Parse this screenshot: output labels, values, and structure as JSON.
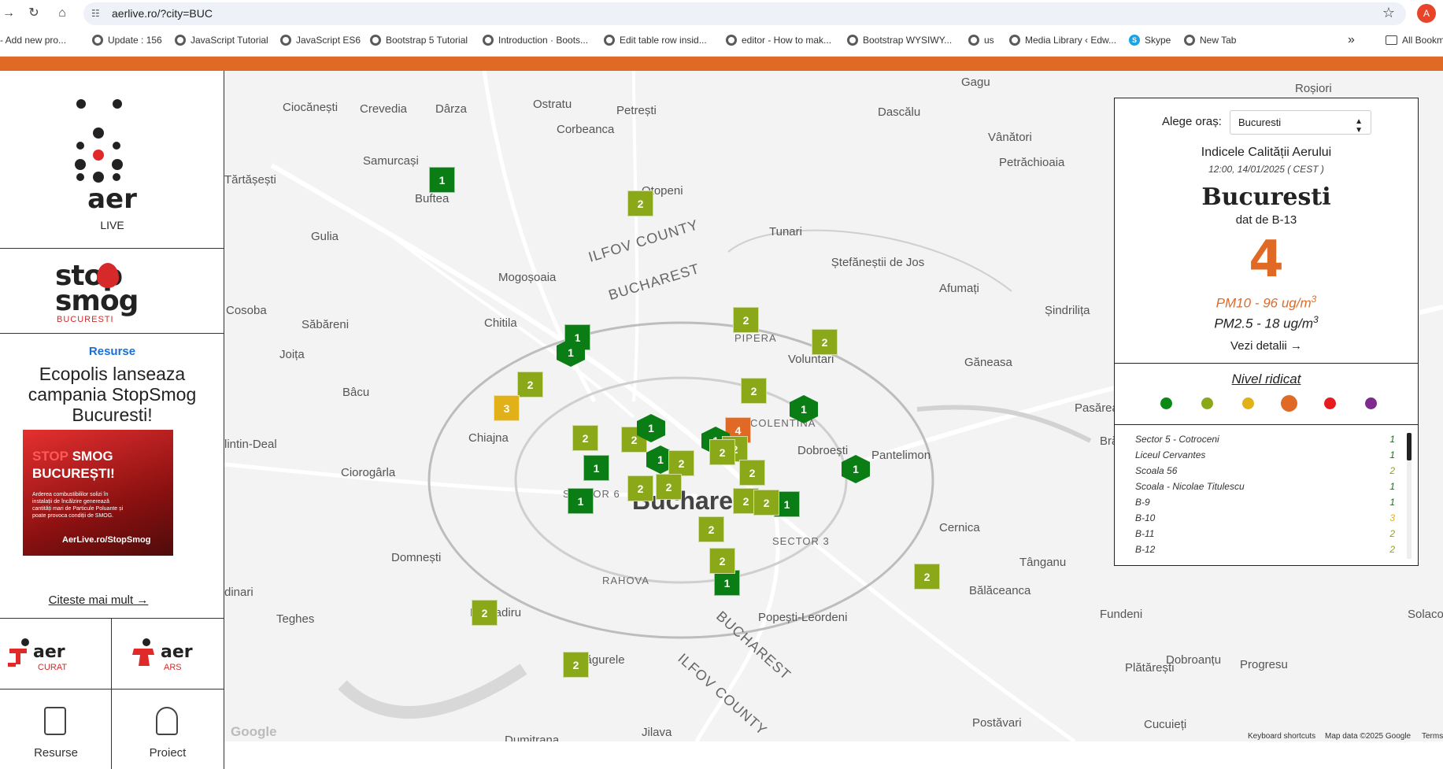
{
  "browser": {
    "url": "aerlive.ro/?city=BUC",
    "avatar_letter": "A",
    "bookmarks": [
      {
        "label": "- Add new pro..."
      },
      {
        "label": "Update : 156"
      },
      {
        "label": "JavaScript Tutorial"
      },
      {
        "label": "JavaScript ES6"
      },
      {
        "label": "Bootstrap 5 Tutorial"
      },
      {
        "label": "Introduction · Boots..."
      },
      {
        "label": "Edit table row insid..."
      },
      {
        "label": "editor - How to mak..."
      },
      {
        "label": "Bootstrap WYSIWY..."
      },
      {
        "label": "us"
      },
      {
        "label": "Media Library ‹ Edw..."
      },
      {
        "label": "Skype"
      },
      {
        "label": "New Tab"
      }
    ],
    "more": "»",
    "all_bookmarks": "All Bookm"
  },
  "sidebar": {
    "logo_text": "aer",
    "logo_sub": "LIVE",
    "stopsmog_line1": "stop",
    "stopsmog_line2": "smog",
    "stopsmog_city": "BUCURESTI",
    "resources_label": "Resurse",
    "article_title": "Ecopolis lanseaza campania StopSmog Bucuresti!",
    "poster": {
      "line1_red": "STOP",
      "line1_white": " SMOG",
      "line2": "BUCUREȘTI!",
      "body": "Arderea combustibililor solizi în instalații de încălzire generează cantități mari de Particule Poluante și poate provoca condiții de SMOG.",
      "site": "AerLive.ro/StopSmog"
    },
    "read_more": "Citeste mai mult",
    "aer_curat_logo": "aer",
    "aer_curat_sub": "CURAT",
    "aer_ars_logo": "aer",
    "aer_ars_sub": "ARS",
    "nav_resources": "Resurse",
    "nav_project": "Proiect"
  },
  "map": {
    "labels": [
      {
        "text": "Ciocănești"
      },
      {
        "text": "Crevedia"
      },
      {
        "text": "Dârza"
      },
      {
        "text": "Ostratu"
      },
      {
        "text": "Petrești"
      },
      {
        "text": "Corbeanca"
      },
      {
        "text": "Dascălu"
      },
      {
        "text": "Gagu"
      },
      {
        "text": "Roșiori"
      },
      {
        "text": "Samurcași"
      },
      {
        "text": "Buftea"
      },
      {
        "text": "Tărtășești"
      },
      {
        "text": "Otopeni"
      },
      {
        "text": "Vânători"
      },
      {
        "text": "Petrăchioaia"
      },
      {
        "text": "Gulia"
      },
      {
        "text": "Tunari"
      },
      {
        "text": "Ștefăneștii de Jos"
      },
      {
        "text": "Mogoșoaia"
      },
      {
        "text": "Afumați"
      },
      {
        "text": "Șindrilița"
      },
      {
        "text": "Cosoba"
      },
      {
        "text": "Săbăreni"
      },
      {
        "text": "Chitila"
      },
      {
        "text": "PIPERA"
      },
      {
        "text": "Voluntari"
      },
      {
        "text": "Joița"
      },
      {
        "text": "Găneasa"
      },
      {
        "text": "Bâcu"
      },
      {
        "text": "Pasărea"
      },
      {
        "text": "Chiajna"
      },
      {
        "text": "COLENTINA"
      },
      {
        "text": "Brănești"
      },
      {
        "text": "Dobroești"
      },
      {
        "text": "Pantelimon"
      },
      {
        "text": "Ciorogârla"
      },
      {
        "text": "SECTOR 6"
      },
      {
        "text": "Bucharest"
      },
      {
        "text": "SECTOR 3"
      },
      {
        "text": "Cernica"
      },
      {
        "text": "Domnești"
      },
      {
        "text": "RAHOVA"
      },
      {
        "text": "Tânganu"
      },
      {
        "text": "Bălăceanca"
      },
      {
        "text": "Teghes"
      },
      {
        "text": "Măgurele"
      },
      {
        "text": "Popești-Leordeni"
      },
      {
        "text": "Fundeni"
      },
      {
        "text": "Plătărești"
      },
      {
        "text": "Dobroanțu"
      },
      {
        "text": "Progresu"
      },
      {
        "text": "Jilava"
      },
      {
        "text": "Postăvari"
      },
      {
        "text": "Cucuieți"
      },
      {
        "text": "Dumitrana"
      },
      {
        "text": "Bragadiru"
      },
      {
        "text": "lintin-Deal"
      },
      {
        "text": "dinari"
      },
      {
        "text": "Solaco"
      }
    ],
    "county_labels": [
      "ILFOV COUNTY",
      "BUCHAREST",
      "BUCHAREST",
      "ILFOV COUNTY"
    ],
    "markers": [
      {
        "value": "1",
        "level": 1,
        "shape": "square"
      },
      {
        "value": "2",
        "level": 2,
        "shape": "square"
      },
      {
        "value": "1",
        "level": 1,
        "shape": "hex"
      },
      {
        "value": "2",
        "level": 2,
        "shape": "square"
      },
      {
        "value": "2",
        "level": 2,
        "shape": "square"
      },
      {
        "value": "1",
        "level": 1,
        "shape": "square"
      },
      {
        "value": "1",
        "level": 1,
        "shape": "hex"
      },
      {
        "value": "2",
        "level": 2,
        "shape": "square"
      },
      {
        "value": "3",
        "level": 3,
        "shape": "square"
      },
      {
        "value": "2",
        "level": 2,
        "shape": "square"
      },
      {
        "value": "1",
        "level": 1,
        "shape": "hex"
      },
      {
        "value": "4",
        "level": 4,
        "shape": "square"
      },
      {
        "value": "2",
        "level": 2,
        "shape": "square"
      },
      {
        "value": "2",
        "level": 2,
        "shape": "square"
      },
      {
        "value": "1",
        "level": 1,
        "shape": "hex"
      },
      {
        "value": "1",
        "level": 1,
        "shape": "hex"
      },
      {
        "value": "2",
        "level": 2,
        "shape": "square"
      },
      {
        "value": "1",
        "level": 1,
        "shape": "hex"
      },
      {
        "value": "2",
        "level": 2,
        "shape": "square"
      },
      {
        "value": "1",
        "level": 1,
        "shape": "square"
      },
      {
        "value": "2",
        "level": 2,
        "shape": "square"
      },
      {
        "value": "1",
        "level": 1,
        "shape": "hex"
      },
      {
        "value": "2",
        "level": 2,
        "shape": "square"
      },
      {
        "value": "2",
        "level": 2,
        "shape": "square"
      },
      {
        "value": "1",
        "level": 1,
        "shape": "square"
      },
      {
        "value": "1",
        "level": 1,
        "shape": "square"
      },
      {
        "value": "2",
        "level": 2,
        "shape": "square"
      },
      {
        "value": "2",
        "level": 2,
        "shape": "square"
      },
      {
        "value": "2",
        "level": 2,
        "shape": "square"
      },
      {
        "value": "1",
        "level": 1,
        "shape": "square"
      },
      {
        "value": "2",
        "level": 2,
        "shape": "square"
      },
      {
        "value": "2",
        "level": 2,
        "shape": "square"
      },
      {
        "value": "2",
        "level": 2,
        "shape": "square"
      },
      {
        "value": "2",
        "level": 2,
        "shape": "square"
      },
      {
        "value": "2",
        "level": 2,
        "shape": "square"
      }
    ],
    "google_logo": "Google",
    "attribution": {
      "shortcuts": "Keyboard shortcuts",
      "data": "Map data ©2025 Google",
      "terms": "Terms"
    }
  },
  "panel": {
    "choose_label": "Alege oraș:",
    "selected_city": "Bucuresti",
    "aqi_title": "Indicele Calității Aerului",
    "timestamp": "12:00, 14/01/2025 ( CEST )",
    "city": "Bucuresti",
    "source": "dat de B-13",
    "index": "4",
    "pm10": "PM10 - 96 ug/m",
    "pm25": "PM2.5 - 18 ug/m",
    "unit_exp": "3",
    "details": "Vezi detalii",
    "level_title": "Nivel ridicat",
    "level_colors": [
      "#0a8a14",
      "#8aa817",
      "#e0b118",
      "#e06a25",
      "#e81c1c",
      "#7e2a8e"
    ],
    "selected_level": 4,
    "stations": [
      {
        "name": "Sector 5 - Cotroceni",
        "value": "1"
      },
      {
        "name": "Liceul Cervantes",
        "value": "1"
      },
      {
        "name": "Scoala 56",
        "value": "2"
      },
      {
        "name": "Scoala - Nicolae Titulescu",
        "value": "1"
      },
      {
        "name": "B-9",
        "value": "1"
      },
      {
        "name": "B-10",
        "value": "3"
      },
      {
        "name": "B-11",
        "value": "2"
      },
      {
        "name": "B-12",
        "value": "2"
      }
    ]
  },
  "colors": {
    "accent": "#e06a25",
    "level1": "#0a7d14",
    "level2": "#8aa817",
    "level3": "#e0b118",
    "level4": "#e06a25"
  }
}
